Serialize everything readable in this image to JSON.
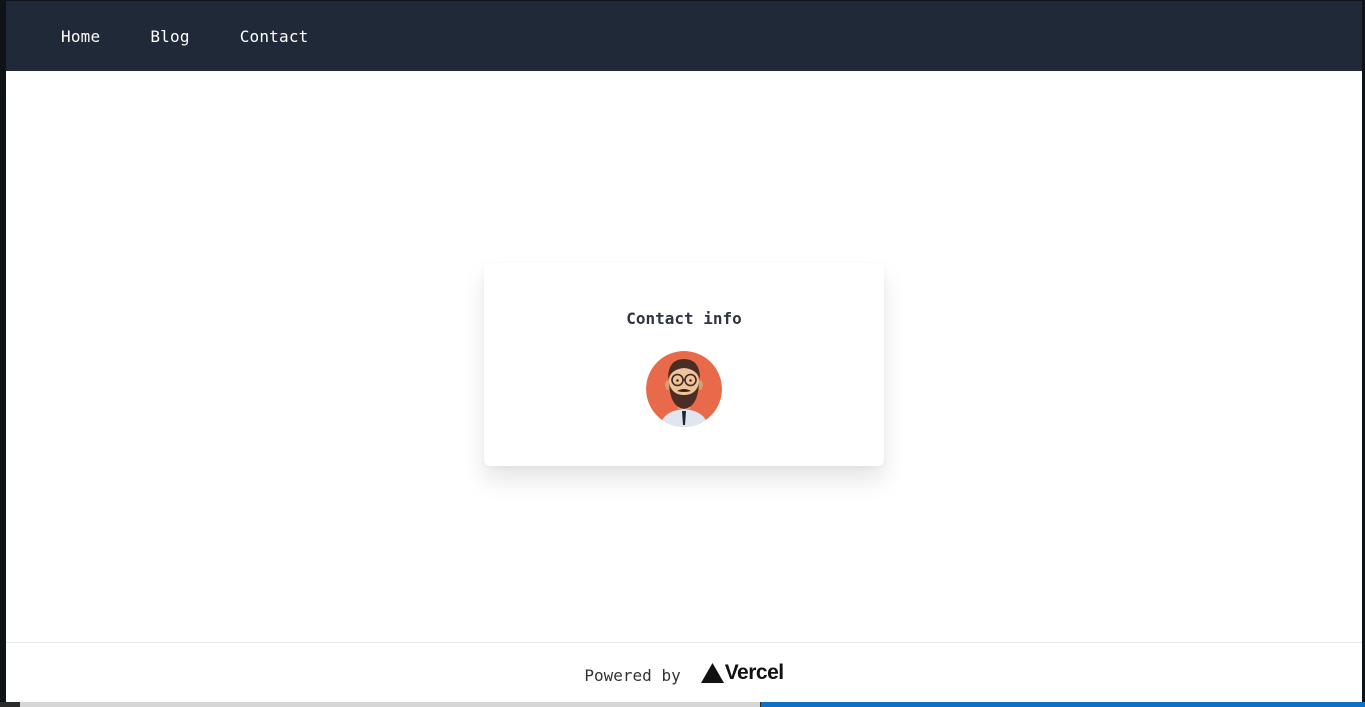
{
  "nav": {
    "items": [
      {
        "label": "Home"
      },
      {
        "label": "Blog"
      },
      {
        "label": "Contact"
      }
    ]
  },
  "card": {
    "title": "Contact info",
    "avatar_icon": "bearded-man-avatar"
  },
  "footer": {
    "powered_label": "Powered by",
    "brand": "Vercel",
    "brand_icon": "vercel-triangle-icon"
  },
  "colors": {
    "navbar_bg": "#202938",
    "avatar_bg": "#e86a4b",
    "text_dark": "#2f3542"
  }
}
